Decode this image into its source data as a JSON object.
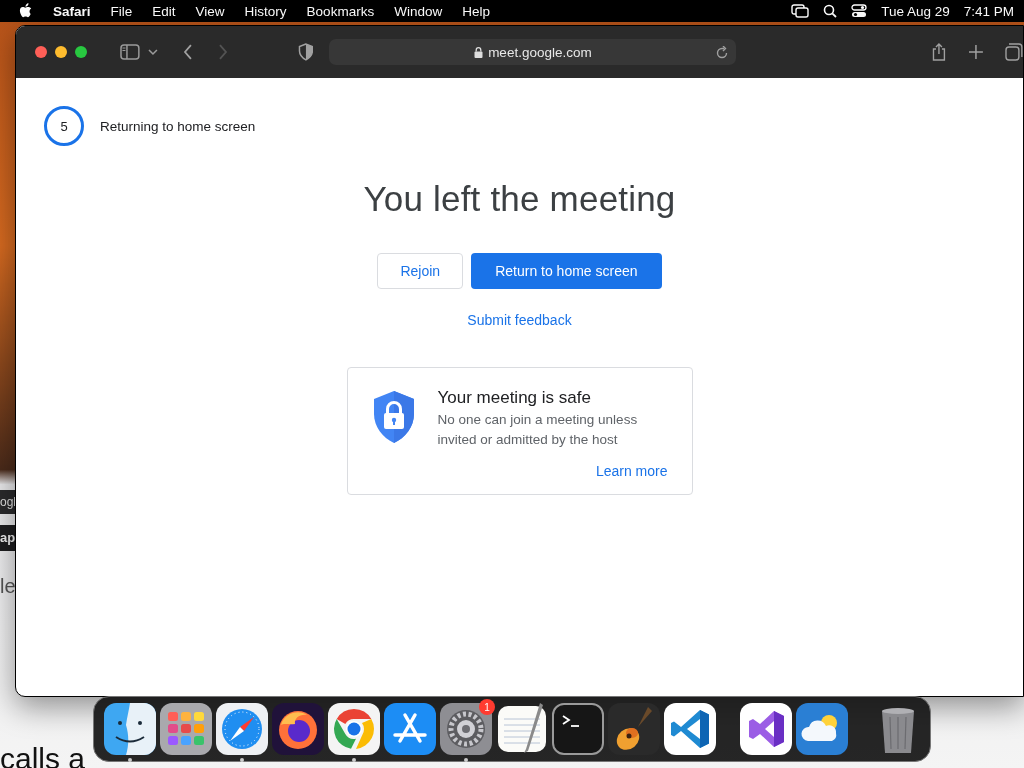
{
  "menu_bar": {
    "app": "Safari",
    "items": [
      "File",
      "Edit",
      "View",
      "History",
      "Bookmarks",
      "Window",
      "Help"
    ],
    "date": "Tue Aug 29",
    "time": "7:41 PM"
  },
  "background_fragments": [
    "ogl",
    "ap",
    "le",
    "calls a"
  ],
  "browser": {
    "address": "meet.google.com",
    "forward_disabled": true
  },
  "page": {
    "countdown": "5",
    "countdown_label": "Returning to home screen",
    "heading": "You left the meeting",
    "buttons": [
      {
        "label": "Rejoin",
        "kind": "outlined"
      },
      {
        "label": "Return to home screen",
        "kind": "filled"
      }
    ],
    "feedback_link": "Submit feedback",
    "card": {
      "title": "Your meeting is safe",
      "text": "No one can join a meeting unless invited or admitted by the host",
      "link": "Learn more"
    }
  },
  "dock": {
    "groups": [
      [
        {
          "kind": "finder",
          "running": true
        },
        {
          "kind": "launchpad",
          "running": false
        },
        {
          "kind": "safari",
          "running": true
        },
        {
          "kind": "firefox",
          "running": false
        },
        {
          "kind": "chrome",
          "running": true
        },
        {
          "kind": "appstore",
          "running": false
        },
        {
          "kind": "settings",
          "running": true,
          "badge": "1"
        },
        {
          "kind": "textedit",
          "running": false
        },
        {
          "kind": "terminal",
          "running": false
        },
        {
          "kind": "guitar",
          "running": false
        },
        {
          "kind": "vscode",
          "running": false
        }
      ],
      [
        {
          "kind": "visualstudio",
          "running": false
        },
        {
          "kind": "weather",
          "running": false
        }
      ],
      [
        {
          "kind": "trash",
          "running": false
        }
      ]
    ]
  }
}
